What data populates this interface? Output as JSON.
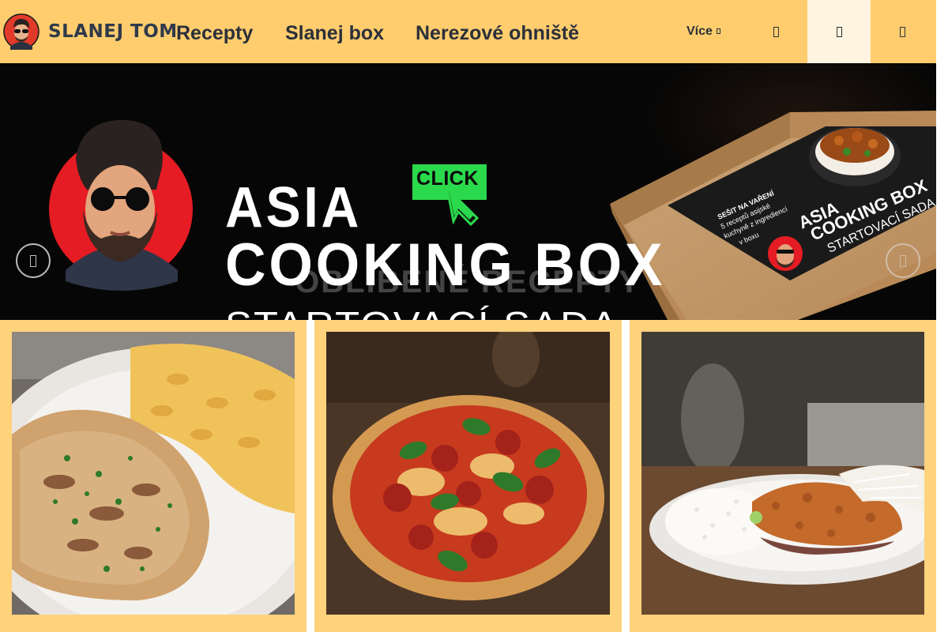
{
  "header": {
    "brand": "SLANEJ TOM",
    "nav": [
      "Recepty",
      "Slanej box",
      "Nerezové ohniště"
    ],
    "more_label": "Více",
    "icons": [
      "search-icon",
      "user-icon",
      "cart-icon"
    ]
  },
  "banner": {
    "title_line1": "ASIA",
    "title_line2": "COOKING BOX",
    "title_line3": "STARTOVACÍ SADA",
    "badge": "CLICK",
    "box_text": {
      "note_line1": "SEŠIT NA VAŘENÍ",
      "note_line2": "5 receptů asijské",
      "note_line3": "kuchyně z ingrediencí",
      "note_line4": "v boxu",
      "box_title1": "ASIA",
      "box_title2": "COOKING BOX",
      "box_title3": "STARTOVACÍ SADA"
    }
  },
  "section_title": "OBLÍBENÉ RECEPTY",
  "cards": [
    {
      "photo": "beef-stroganoff-with-fusilli-pasta"
    },
    {
      "photo": "pepperoni-pizza-with-basil"
    },
    {
      "photo": "fried-chicken-schnitzel-with-rice-and-coleslaw"
    }
  ],
  "colors": {
    "header_bg": "#ffcd6e",
    "card_bg": "#ffd27c",
    "banner_bg": "#060606",
    "text_dark": "#2b2f3a",
    "accent_green": "#2bd94c"
  }
}
